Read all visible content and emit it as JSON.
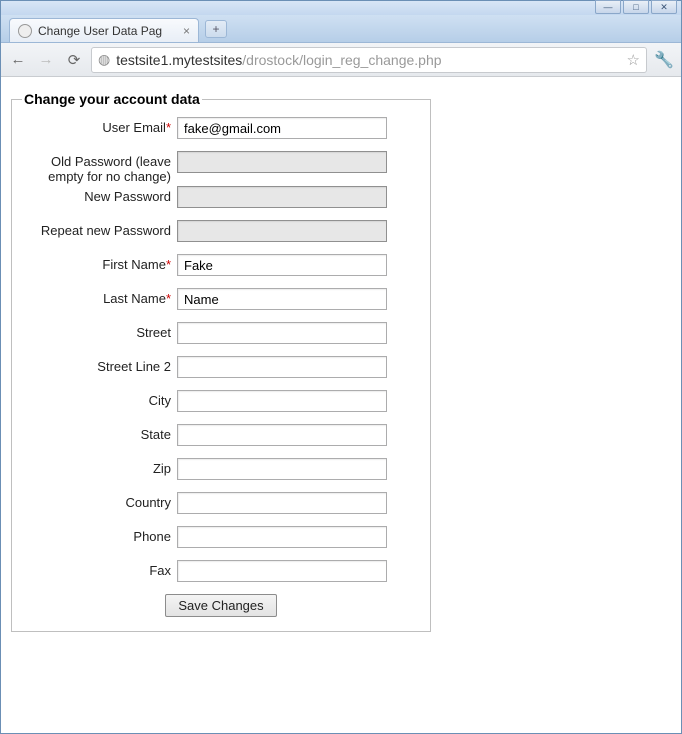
{
  "window": {
    "controls": {
      "min": "—",
      "max": "□",
      "close": "✕"
    }
  },
  "browser": {
    "tab_title": "Change User Data Pag",
    "tab_close": "×",
    "new_tab": "+",
    "nav": {
      "back": "←",
      "forward": "→",
      "reload": "⟳"
    },
    "url_dark": "testsite1.mytestsites",
    "url_rest": "/drostock/login_reg_change.php",
    "star": "☆",
    "wrench": "🔧"
  },
  "form": {
    "legend": "Change your account data",
    "labels": {
      "email": "User Email",
      "old_pw": "Old Password (leave empty for no change)",
      "new_pw": "New Password",
      "repeat_pw": "Repeat new Password",
      "first": "First Name",
      "last": "Last Name",
      "street": "Street",
      "street2": "Street Line 2",
      "city": "City",
      "state": "State",
      "zip": "Zip",
      "country": "Country",
      "phone": "Phone",
      "fax": "Fax"
    },
    "required_mark": "*",
    "values": {
      "email": "fake@gmail.com",
      "old_pw": "",
      "new_pw": "",
      "repeat_pw": "",
      "first": "Fake",
      "last": "Name",
      "street": "",
      "street2": "",
      "city": "",
      "state": "",
      "zip": "",
      "country": "",
      "phone": "",
      "fax": ""
    },
    "submit": "Save Changes"
  }
}
